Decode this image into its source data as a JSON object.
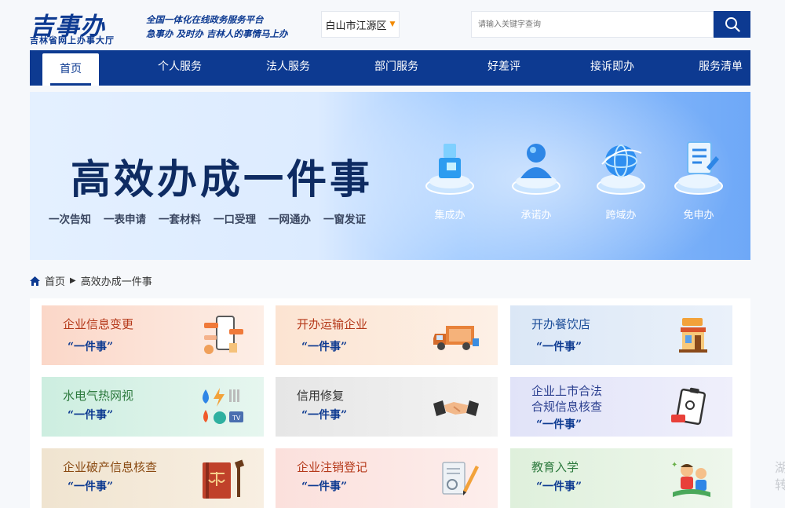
{
  "header": {
    "logo_main": "吉事办",
    "logo_sub": "吉林省网上办事大厅",
    "slogan_line1": "全国一体化在线政务服务平台",
    "slogan_line2": "急事办 及时办 吉林人的事情马上办",
    "region": "白山市江源区",
    "search_placeholder": "请输入关键字查询"
  },
  "nav": {
    "items": [
      "首页",
      "个人服务",
      "法人服务",
      "部门服务",
      "好差评",
      "接诉即办",
      "服务清单"
    ],
    "active": "首页"
  },
  "banner": {
    "title": "高效办成一件事",
    "tags": [
      "一次告知",
      "一表申请",
      "一套材料",
      "一口受理",
      "一网通办",
      "一窗发证"
    ],
    "features": [
      "集成办",
      "承诺办",
      "跨域办",
      "免申办"
    ]
  },
  "breadcrumb": {
    "home": "首页",
    "current": "高效办成一件事"
  },
  "cards": [
    {
      "title": "企业信息变更",
      "sub": "“一件事”",
      "title_color": "#b5391a",
      "bg": "linear-gradient(90deg,#fbd7c8,#fdeee6)",
      "icon": "phone-info-icon"
    },
    {
      "title": "开办运输企业",
      "sub": "“一件事”",
      "title_color": "#b5391a",
      "bg": "linear-gradient(90deg,#fce4d2,#fdf0e6)",
      "icon": "truck-icon"
    },
    {
      "title": "开办餐饮店",
      "sub": "“一件事”",
      "title_color": "#1e4f9a",
      "bg": "linear-gradient(90deg,#dbe7f6,#eaf1fa)",
      "icon": "restaurant-icon"
    },
    {
      "title": "水电气热网视",
      "sub": "“一件事”",
      "title_color": "#2d7a3e",
      "bg": "linear-gradient(90deg,#cdeee0,#e6f6ef)",
      "icon": "utilities-icon"
    },
    {
      "title": "信用修复",
      "sub": "“一件事”",
      "title_color": "#333333",
      "bg": "linear-gradient(90deg,#e6e6e6,#f3f3f3)",
      "icon": "handshake-icon"
    },
    {
      "title": "企业上市合法\n合规信息核查",
      "sub": "“一件事”",
      "title_color": "#2b3f8f",
      "bg": "linear-gradient(90deg,#e1e3f8,#efeffb)",
      "icon": "checklist-icon"
    },
    {
      "title": "企业破产信息核查",
      "sub": "“一件事”",
      "title_color": "#8a4a12",
      "bg": "linear-gradient(90deg,#f0e4d0,#f8efe2)",
      "icon": "law-book-icon"
    },
    {
      "title": "企业注销登记",
      "sub": "“一件事”",
      "title_color": "#b5391a",
      "bg": "linear-gradient(90deg,#fbe0dc,#fdeeec)",
      "icon": "document-pen-icon"
    },
    {
      "title": "教育入学",
      "sub": "“一件事”",
      "title_color": "#2d7a3e",
      "bg": "linear-gradient(90deg,#dff0dc,#eef7ec)",
      "icon": "student-icon"
    }
  ],
  "side_text": "湖\n转"
}
